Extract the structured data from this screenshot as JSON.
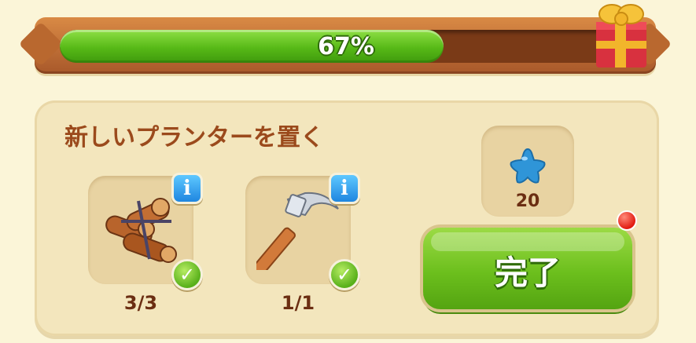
{
  "progress": {
    "label": "67%",
    "value": 0.67
  },
  "task": {
    "title": "新しいプランターを置く",
    "requirements": [
      {
        "icon": "logs-icon",
        "count": "3/3",
        "completed": true,
        "info": "i"
      },
      {
        "icon": "hammer-icon",
        "count": "1/1",
        "completed": true,
        "info": "i"
      }
    ],
    "reward": {
      "icon": "blue-star-icon",
      "count": "20"
    },
    "complete_button": {
      "label": "完了"
    }
  },
  "check_glyph": "✓",
  "colors": {
    "progress_fill": "#57b917",
    "frame": "#b9682f",
    "title": "#9b4a1c",
    "button": "#6cbf1d",
    "notify": "#e21c12",
    "reward_star": "#2f95d8"
  }
}
